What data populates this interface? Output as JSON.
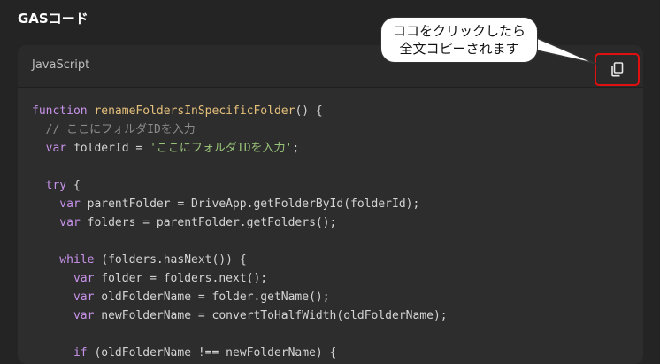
{
  "section": {
    "title": "GASコード"
  },
  "code_block": {
    "language": "JavaScript",
    "copy_icon": "copy-icon",
    "lines": [
      [
        [
          "kw2",
          "function "
        ],
        [
          "fn",
          "renameFoldersInSpecificFolder"
        ],
        [
          "",
          "() {"
        ]
      ],
      [
        [
          "cm",
          "  // ここにフォルダIDを入力"
        ]
      ],
      [
        [
          "kw2",
          "  var "
        ],
        [
          "",
          "folderId = "
        ],
        [
          "str",
          "'ここにフォルダIDを入力'"
        ],
        [
          "",
          ";"
        ]
      ],
      [
        [
          "",
          ""
        ]
      ],
      [
        [
          "kw2",
          "  try "
        ],
        [
          "",
          "{"
        ]
      ],
      [
        [
          "kw2",
          "    var "
        ],
        [
          "",
          "parentFolder = DriveApp.getFolderById(folderId);"
        ]
      ],
      [
        [
          "kw2",
          "    var "
        ],
        [
          "",
          "folders = parentFolder.getFolders();"
        ]
      ],
      [
        [
          "",
          ""
        ]
      ],
      [
        [
          "kw2",
          "    while "
        ],
        [
          "",
          "(folders.hasNext()) {"
        ]
      ],
      [
        [
          "kw2",
          "      var "
        ],
        [
          "",
          "folder = folders.next();"
        ]
      ],
      [
        [
          "kw2",
          "      var "
        ],
        [
          "",
          "oldFolderName = folder.getName();"
        ]
      ],
      [
        [
          "kw2",
          "      var "
        ],
        [
          "",
          "newFolderName = convertToHalfWidth(oldFolderName);"
        ]
      ],
      [
        [
          "",
          ""
        ]
      ],
      [
        [
          "kw2",
          "      if "
        ],
        [
          "",
          "(oldFolderName !== newFolderName) {"
        ]
      ]
    ]
  },
  "callout": {
    "line1": "ココをクリックしたら",
    "line2": "全文コピーされます"
  },
  "colors": {
    "highlight_border": "#e01010",
    "keyword": "#c792ea",
    "function_name": "#e5c07b",
    "string": "#98c379",
    "comment": "#8b8b8b"
  }
}
